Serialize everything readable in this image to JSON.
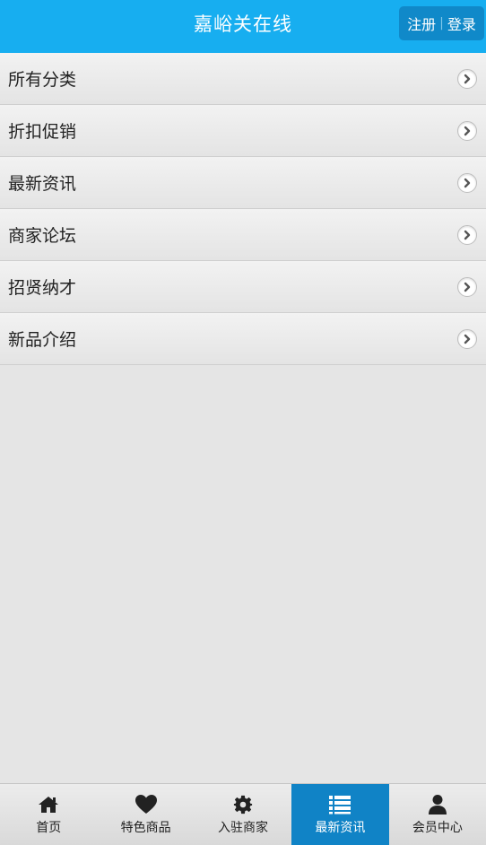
{
  "header": {
    "title": "嘉峪关在线",
    "register_label": "注册",
    "separator": "|",
    "login_label": "登录"
  },
  "menu": {
    "items": [
      {
        "label": "所有分类"
      },
      {
        "label": "折扣促销"
      },
      {
        "label": "最新资讯"
      },
      {
        "label": "商家论坛"
      },
      {
        "label": "招贤纳才"
      },
      {
        "label": "新品介绍"
      }
    ]
  },
  "bottom_nav": {
    "active_index": 3,
    "items": [
      {
        "label": "首页",
        "icon": "home-icon"
      },
      {
        "label": "特色商品",
        "icon": "heart-icon"
      },
      {
        "label": "入驻商家",
        "icon": "gear-icon"
      },
      {
        "label": "最新资讯",
        "icon": "list-icon"
      },
      {
        "label": "会员中心",
        "icon": "user-icon"
      }
    ]
  },
  "colors": {
    "header_bg": "#17aef0",
    "auth_bg": "#1089c9",
    "nav_active_bg": "#1083c6",
    "page_bg": "#e5e5e5"
  }
}
